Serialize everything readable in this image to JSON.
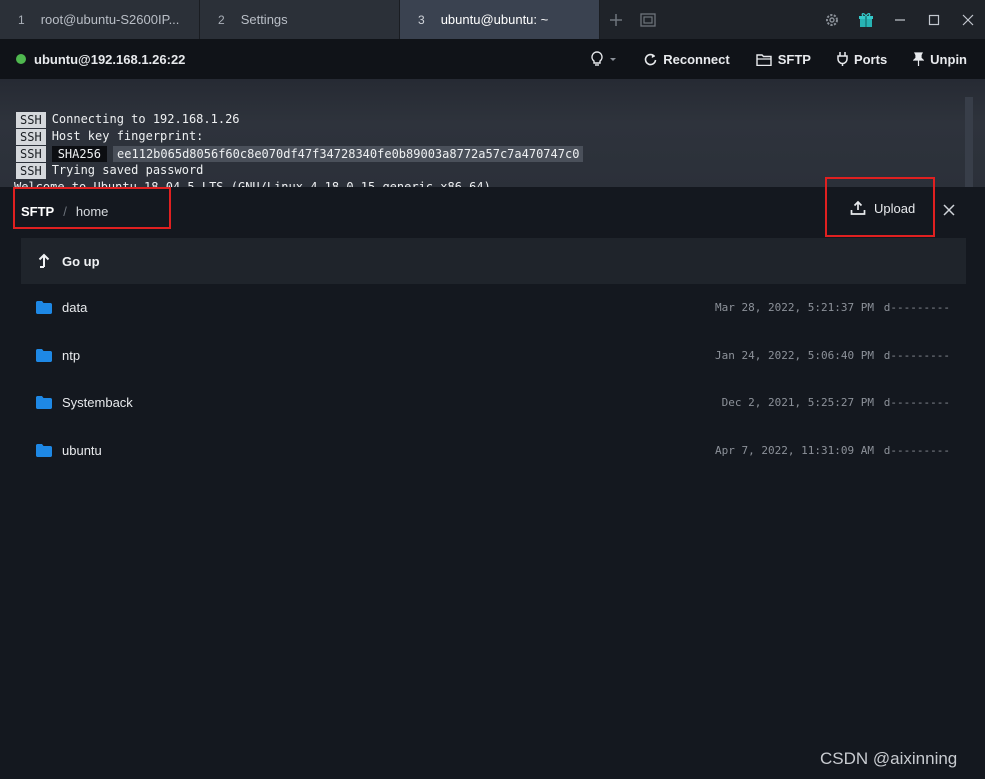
{
  "tabs": [
    {
      "num": "1",
      "label": "root@ubuntu-S2600IP..."
    },
    {
      "num": "2",
      "label": "Settings"
    },
    {
      "num": "3",
      "label": "ubuntu@ubuntu: ~"
    }
  ],
  "toolbar": {
    "host": "ubuntu@192.168.1.26:22",
    "reconnect": "Reconnect",
    "sftp": "SFTP",
    "ports": "Ports",
    "unpin": "Unpin"
  },
  "terminal": {
    "badge": "SSH",
    "line1": "Connecting to 192.168.1.26",
    "line2": "Host key fingerprint:",
    "sha_label": "SHA256",
    "fingerprint": "ee112b065d8056f60c8e070df47f34728340fe0b89003a8772a57c7a470747c0",
    "line4": "Trying saved password",
    "line5": "Welcome to Ubuntu 18.04.5 LTS (GNU/Linux 4.18.0-15-generic x86_64)"
  },
  "sftp": {
    "root": "SFTP",
    "separator": "/",
    "dir": "home",
    "upload": "Upload",
    "go_up": "Go up",
    "files": [
      {
        "name": "data",
        "date": "Mar 28, 2022, 5:21:37 PM",
        "perm": "d---------"
      },
      {
        "name": "ntp",
        "date": "Jan 24, 2022, 5:06:40 PM",
        "perm": "d---------"
      },
      {
        "name": "Systemback",
        "date": "Dec 2, 2021, 5:25:27 PM",
        "perm": "d---------"
      },
      {
        "name": "ubuntu",
        "date": "Apr 7, 2022, 11:31:09 AM",
        "perm": "d---------"
      }
    ]
  },
  "colors": {
    "status_connected": "#4fb84f",
    "folder_icon": "#1e88e5",
    "highlight_box": "#e02020"
  },
  "watermark": "CSDN @aixinning"
}
